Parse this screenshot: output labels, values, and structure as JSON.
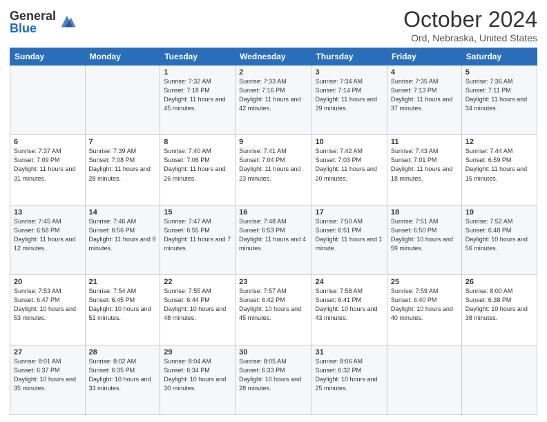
{
  "header": {
    "logo_general": "General",
    "logo_blue": "Blue",
    "title": "October 2024",
    "location": "Ord, Nebraska, United States"
  },
  "weekdays": [
    "Sunday",
    "Monday",
    "Tuesday",
    "Wednesday",
    "Thursday",
    "Friday",
    "Saturday"
  ],
  "weeks": [
    [
      {
        "day": "",
        "info": ""
      },
      {
        "day": "",
        "info": ""
      },
      {
        "day": "1",
        "info": "Sunrise: 7:32 AM\nSunset: 7:18 PM\nDaylight: 11 hours and 45 minutes."
      },
      {
        "day": "2",
        "info": "Sunrise: 7:33 AM\nSunset: 7:16 PM\nDaylight: 11 hours and 42 minutes."
      },
      {
        "day": "3",
        "info": "Sunrise: 7:34 AM\nSunset: 7:14 PM\nDaylight: 11 hours and 39 minutes."
      },
      {
        "day": "4",
        "info": "Sunrise: 7:35 AM\nSunset: 7:13 PM\nDaylight: 11 hours and 37 minutes."
      },
      {
        "day": "5",
        "info": "Sunrise: 7:36 AM\nSunset: 7:11 PM\nDaylight: 11 hours and 34 minutes."
      }
    ],
    [
      {
        "day": "6",
        "info": "Sunrise: 7:37 AM\nSunset: 7:09 PM\nDaylight: 11 hours and 31 minutes."
      },
      {
        "day": "7",
        "info": "Sunrise: 7:39 AM\nSunset: 7:08 PM\nDaylight: 11 hours and 28 minutes."
      },
      {
        "day": "8",
        "info": "Sunrise: 7:40 AM\nSunset: 7:06 PM\nDaylight: 11 hours and 26 minutes."
      },
      {
        "day": "9",
        "info": "Sunrise: 7:41 AM\nSunset: 7:04 PM\nDaylight: 11 hours and 23 minutes."
      },
      {
        "day": "10",
        "info": "Sunrise: 7:42 AM\nSunset: 7:03 PM\nDaylight: 11 hours and 20 minutes."
      },
      {
        "day": "11",
        "info": "Sunrise: 7:43 AM\nSunset: 7:01 PM\nDaylight: 11 hours and 18 minutes."
      },
      {
        "day": "12",
        "info": "Sunrise: 7:44 AM\nSunset: 6:59 PM\nDaylight: 11 hours and 15 minutes."
      }
    ],
    [
      {
        "day": "13",
        "info": "Sunrise: 7:45 AM\nSunset: 6:58 PM\nDaylight: 11 hours and 12 minutes."
      },
      {
        "day": "14",
        "info": "Sunrise: 7:46 AM\nSunset: 6:56 PM\nDaylight: 11 hours and 9 minutes."
      },
      {
        "day": "15",
        "info": "Sunrise: 7:47 AM\nSunset: 6:55 PM\nDaylight: 11 hours and 7 minutes."
      },
      {
        "day": "16",
        "info": "Sunrise: 7:48 AM\nSunset: 6:53 PM\nDaylight: 11 hours and 4 minutes."
      },
      {
        "day": "17",
        "info": "Sunrise: 7:50 AM\nSunset: 6:51 PM\nDaylight: 11 hours and 1 minute."
      },
      {
        "day": "18",
        "info": "Sunrise: 7:51 AM\nSunset: 6:50 PM\nDaylight: 10 hours and 59 minutes."
      },
      {
        "day": "19",
        "info": "Sunrise: 7:52 AM\nSunset: 6:48 PM\nDaylight: 10 hours and 56 minutes."
      }
    ],
    [
      {
        "day": "20",
        "info": "Sunrise: 7:53 AM\nSunset: 6:47 PM\nDaylight: 10 hours and 53 minutes."
      },
      {
        "day": "21",
        "info": "Sunrise: 7:54 AM\nSunset: 6:45 PM\nDaylight: 10 hours and 51 minutes."
      },
      {
        "day": "22",
        "info": "Sunrise: 7:55 AM\nSunset: 6:44 PM\nDaylight: 10 hours and 48 minutes."
      },
      {
        "day": "23",
        "info": "Sunrise: 7:57 AM\nSunset: 6:42 PM\nDaylight: 10 hours and 45 minutes."
      },
      {
        "day": "24",
        "info": "Sunrise: 7:58 AM\nSunset: 6:41 PM\nDaylight: 10 hours and 43 minutes."
      },
      {
        "day": "25",
        "info": "Sunrise: 7:59 AM\nSunset: 6:40 PM\nDaylight: 10 hours and 40 minutes."
      },
      {
        "day": "26",
        "info": "Sunrise: 8:00 AM\nSunset: 6:38 PM\nDaylight: 10 hours and 38 minutes."
      }
    ],
    [
      {
        "day": "27",
        "info": "Sunrise: 8:01 AM\nSunset: 6:37 PM\nDaylight: 10 hours and 35 minutes."
      },
      {
        "day": "28",
        "info": "Sunrise: 8:02 AM\nSunset: 6:35 PM\nDaylight: 10 hours and 33 minutes."
      },
      {
        "day": "29",
        "info": "Sunrise: 8:04 AM\nSunset: 6:34 PM\nDaylight: 10 hours and 30 minutes."
      },
      {
        "day": "30",
        "info": "Sunrise: 8:05 AM\nSunset: 6:33 PM\nDaylight: 10 hours and 28 minutes."
      },
      {
        "day": "31",
        "info": "Sunrise: 8:06 AM\nSunset: 6:32 PM\nDaylight: 10 hours and 25 minutes."
      },
      {
        "day": "",
        "info": ""
      },
      {
        "day": "",
        "info": ""
      }
    ]
  ]
}
